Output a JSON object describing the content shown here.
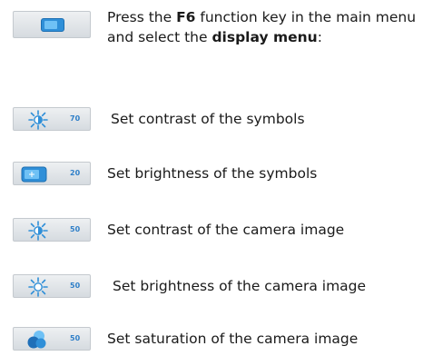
{
  "intro": {
    "pre": "Press the ",
    "key": "F6",
    "mid": " function key in the main menu and select the ",
    "menu": "display menu",
    "post": ":"
  },
  "items": [
    {
      "icon": "sun-contrast-icon",
      "value": "70",
      "label": "Set contrast of the symbols"
    },
    {
      "icon": "display-brightness-icon",
      "value": "20",
      "label": "Set brightness of the symbols"
    },
    {
      "icon": "sun-contrast-icon",
      "value": "50",
      "label": "Set contrast of the camera image"
    },
    {
      "icon": "sun-brightness-icon",
      "value": "50",
      "label": "Set brightness of the camera image"
    },
    {
      "icon": "color-saturation-icon",
      "value": "50",
      "label": "Set saturation of the camera image"
    }
  ],
  "colors": {
    "accent": "#2f8fd8",
    "value_text": "#2f7fc8"
  }
}
